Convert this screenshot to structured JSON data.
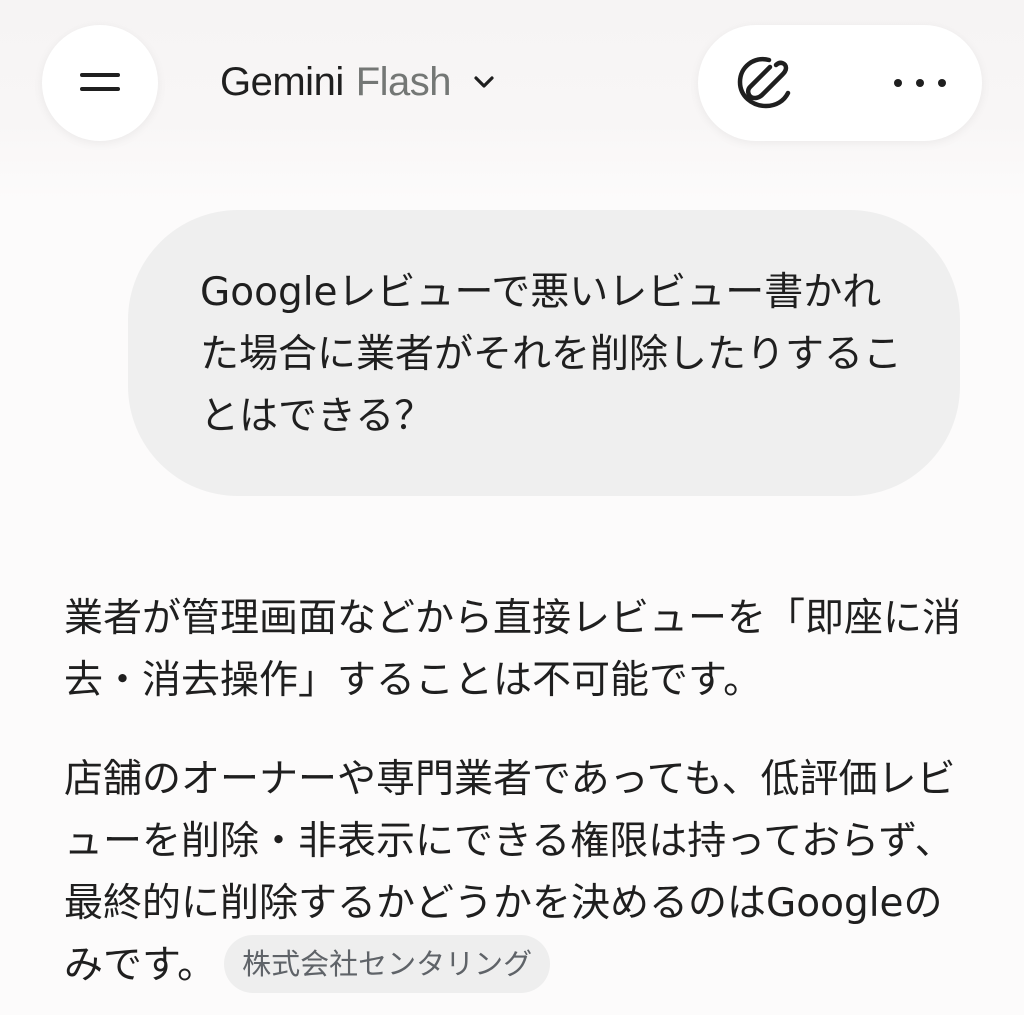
{
  "header": {
    "model_name": "Gemini",
    "model_variant": "Flash",
    "icons": {
      "menu": "menu-icon",
      "chevron": "chevron-down-icon",
      "new_chat": "new-chat-icon",
      "more": "more-horizontal-icon"
    }
  },
  "user_message": {
    "text": "Googleレビューで悪いレビュー書かれた場合に業者がそれを削除したりすることはできる？"
  },
  "response": {
    "paragraph_1": "業者が管理画面などから直接レビューを「即座に消去・消去操作」することは不可能です。",
    "paragraph_2": "店舗のオーナーや専門業者であっても、低評価レビューを削除・非表示にできる権限は持っておらず、最終的に削除するかどうかを決めるのはGoogleのみです。",
    "source_chip": "株式会社センタリング"
  },
  "colors": {
    "background": "#fcfbfb",
    "bubble": "#efefef",
    "text": "#1f1f1f",
    "muted": "#747775",
    "chip": "#eeeeee"
  }
}
